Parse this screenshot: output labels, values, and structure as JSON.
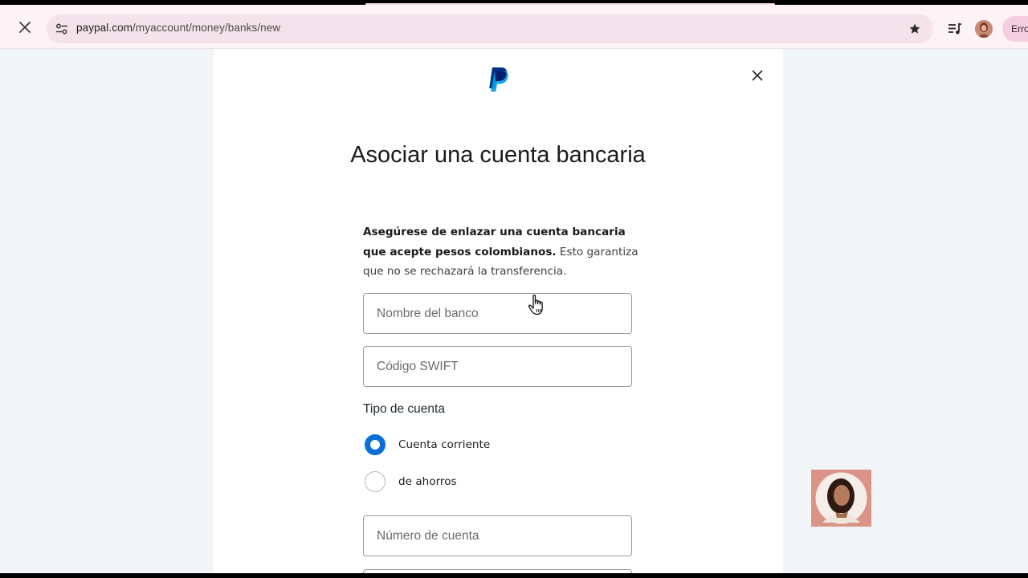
{
  "browser": {
    "url_host": "paypal.com",
    "url_path": "/myaccount/money/banks/new",
    "error_chip_label": "Erro",
    "icons": {
      "stop": "close-icon",
      "site_info": "tune-icon",
      "bookmark": "star-icon",
      "media": "media-queue-icon",
      "profile": "profile-avatar"
    }
  },
  "dialog": {
    "logo": "paypal-logo",
    "title": "Asociar una cuenta bancaria",
    "notice_bold": "Asegúrese de enlazar una cuenta bancaria que acepte pesos colombianos.",
    "notice_rest": " Esto garantiza que no se rechazará la transferencia.",
    "bank_name_placeholder": "Nombre del banco",
    "swift_placeholder": "Código SWIFT",
    "account_type_label": "Tipo de cuenta",
    "account_types": [
      {
        "label": "Cuenta corriente",
        "selected": true
      },
      {
        "label": "de ahorros",
        "selected": false
      }
    ],
    "account_number_placeholder": "Número de cuenta"
  },
  "colors": {
    "radio_selected": "#0b6fd8",
    "paypal_dark": "#003087",
    "paypal_light": "#009cde",
    "omnibox_bg": "#f4e3ea"
  }
}
